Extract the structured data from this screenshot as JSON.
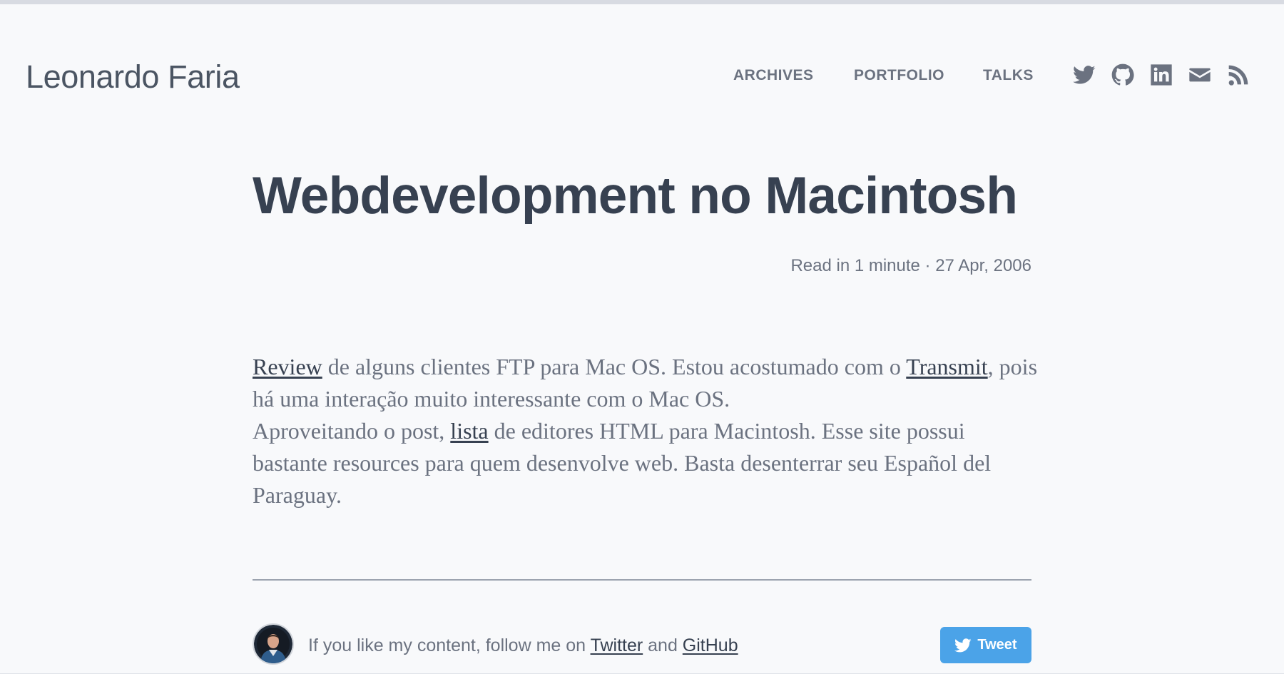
{
  "site": {
    "title": "Leonardo Faria"
  },
  "nav": {
    "items": [
      {
        "label": "ARCHIVES"
      },
      {
        "label": "PORTFOLIO"
      },
      {
        "label": "TALKS"
      }
    ],
    "social_icons": [
      "twitter-icon",
      "github-icon",
      "linkedin-icon",
      "email-icon",
      "rss-icon"
    ]
  },
  "post": {
    "title": "Webdevelopment no Macintosh",
    "meta": "Read in 1 minute · 27 Apr, 2006",
    "paragraph1": {
      "link1": "Review",
      "text1": " de alguns clientes FTP para Mac OS. Estou acostumado com o ",
      "link2": "Transmit",
      "text2": ", pois há uma interação muito interessante com o Mac OS."
    },
    "paragraph2": {
      "text1": "Aproveitando o post, ",
      "link1": "lista",
      "text2": " de editores HTML para Macintosh. Esse site possui bastante resources para quem desenvolve web. Basta desenterrar seu Español del Paraguay."
    }
  },
  "footer": {
    "follow_text": "If you like my content, follow me on ",
    "twitter_link": "Twitter",
    "and_text": " and ",
    "github_link": "GitHub",
    "tweet_button_label": "Tweet"
  },
  "colors": {
    "background": "#f8f9fb",
    "text": "#424a57",
    "muted": "#6b7280",
    "tweet_button": "#4ba3e8"
  }
}
